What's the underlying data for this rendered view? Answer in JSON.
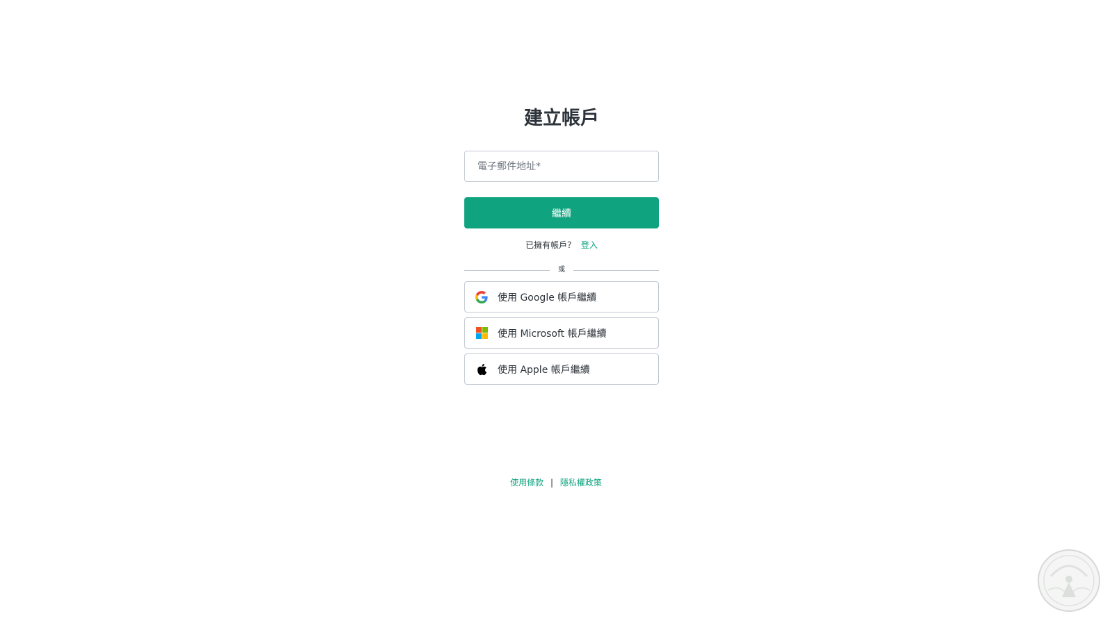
{
  "auth": {
    "title": "建立帳戶",
    "email_placeholder": "電子郵件地址*",
    "email_value": "",
    "continue_label": "繼續",
    "have_account_text": "已擁有帳戶？",
    "login_link": "登入",
    "divider_text": "或",
    "social": [
      {
        "icon": "google-icon",
        "label": "使用 Google 帳戶繼續"
      },
      {
        "icon": "microsoft-icon",
        "label": "使用 Microsoft 帳戶繼續"
      },
      {
        "icon": "apple-icon",
        "label": "使用 Apple 帳戶繼續"
      }
    ]
  },
  "footer": {
    "terms": "使用條款",
    "separator": "|",
    "privacy": "隱私權政策"
  },
  "colors": {
    "accent": "#10a37f",
    "text": "#2d333a",
    "border": "#c2c8d0"
  }
}
